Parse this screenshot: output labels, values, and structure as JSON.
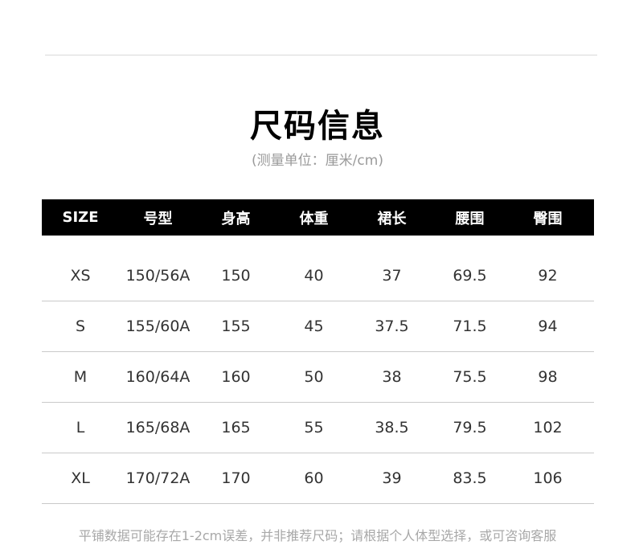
{
  "title": "尺码信息",
  "subtitle": "(测量单位：厘米/cm)",
  "table": {
    "headers": [
      "SIZE",
      "号型",
      "身高",
      "体重",
      "裙长",
      "腰围",
      "臀围"
    ],
    "rows": [
      [
        "XS",
        "150/56A",
        "150",
        "40",
        "37",
        "69.5",
        "92"
      ],
      [
        "S",
        "155/60A",
        "155",
        "45",
        "37.5",
        "71.5",
        "94"
      ],
      [
        "M",
        "160/64A",
        "160",
        "50",
        "38",
        "75.5",
        "98"
      ],
      [
        "L",
        "165/68A",
        "165",
        "55",
        "38.5",
        "79.5",
        "102"
      ],
      [
        "XL",
        "170/72A",
        "170",
        "60",
        "39",
        "83.5",
        "106"
      ]
    ]
  },
  "note": "平铺数据可能存在1-2cm误差，并非推荐尺码；请根据个人体型选择，或可咨询客服"
}
